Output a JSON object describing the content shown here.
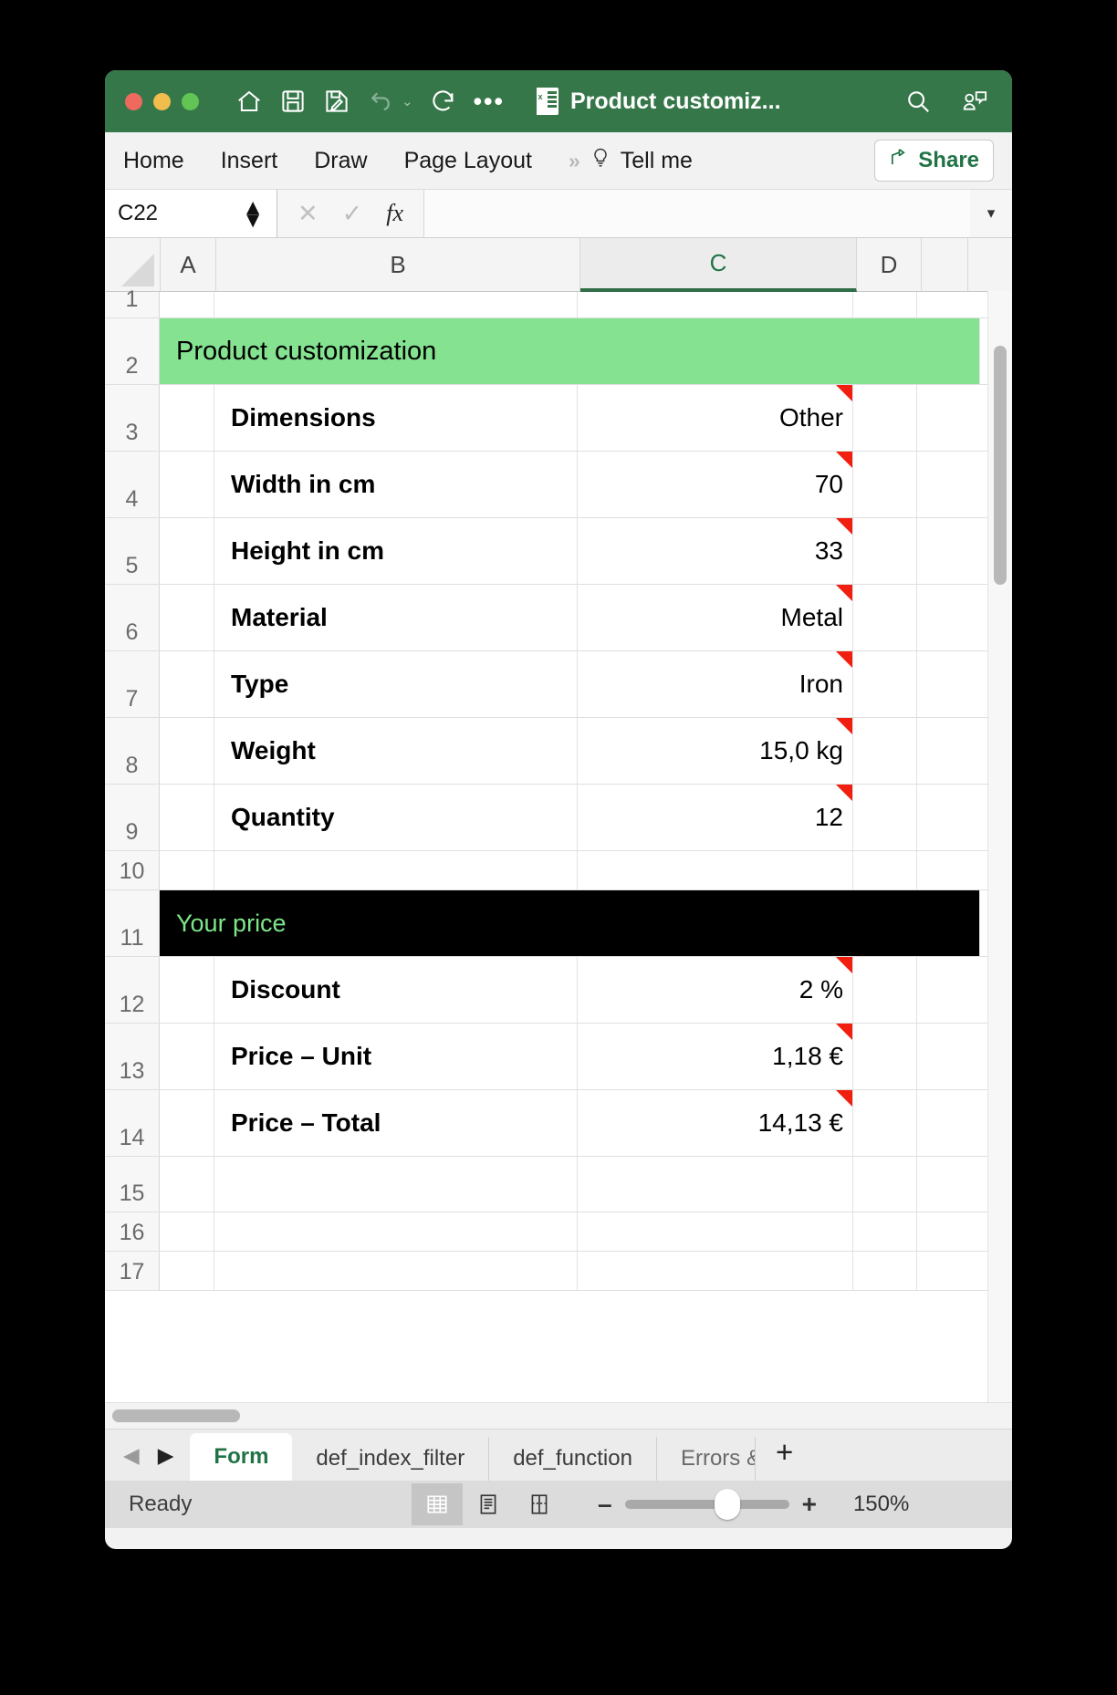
{
  "window": {
    "title": "Product customiz...",
    "file_icon": "excel-file-icon"
  },
  "titlebar": {
    "quick_access": [
      {
        "name": "home-icon",
        "label": "Home"
      },
      {
        "name": "save-icon",
        "label": "Save"
      },
      {
        "name": "save-as-icon",
        "label": "Save As"
      },
      {
        "name": "undo-icon",
        "label": "Undo"
      },
      {
        "name": "undo-dropdown-icon",
        "label": "⌄"
      },
      {
        "name": "redo-icon",
        "label": "Redo"
      },
      {
        "name": "more-commands-icon",
        "label": "•••"
      }
    ],
    "search_icon": "search-icon",
    "collaborate_icon": "comments-person-icon"
  },
  "ribbon": {
    "tabs": [
      "Home",
      "Insert",
      "Draw",
      "Page Layout"
    ],
    "overflow": "»",
    "tell_me": "Tell me",
    "tell_me_icon": "lightbulb-icon",
    "share_label": "Share",
    "share_icon": "share-arrow-icon"
  },
  "formula_bar": {
    "name_box": "C22",
    "cancel_icon": "cancel-x-icon",
    "confirm_icon": "confirm-check-icon",
    "function_icon": "fx-icon",
    "formula_value": "",
    "expand_icon": "chevron-down-icon"
  },
  "grid": {
    "columns": [
      "A",
      "B",
      "C",
      "D"
    ],
    "selected_column": "C",
    "rows": [
      {
        "n": "1",
        "b": "",
        "c": "",
        "comment": false,
        "type": "normal"
      },
      {
        "n": "2",
        "banner": "Product customization",
        "style": "green"
      },
      {
        "n": "3",
        "b": "Dimensions",
        "c": "Other",
        "comment": true,
        "type": "normal"
      },
      {
        "n": "4",
        "b": "Width in cm",
        "c": "70",
        "comment": true,
        "type": "normal"
      },
      {
        "n": "5",
        "b": "Height in cm",
        "c": "33",
        "comment": true,
        "type": "normal"
      },
      {
        "n": "6",
        "b": "Material",
        "c": "Metal",
        "comment": true,
        "type": "normal"
      },
      {
        "n": "7",
        "b": "Type",
        "c": "Iron",
        "comment": true,
        "type": "normal"
      },
      {
        "n": "8",
        "b": "Weight",
        "c": "15,0 kg",
        "comment": true,
        "type": "normal"
      },
      {
        "n": "9",
        "b": "Quantity",
        "c": "12",
        "comment": true,
        "type": "normal"
      },
      {
        "n": "10",
        "b": "",
        "c": "",
        "comment": false,
        "type": "normal"
      },
      {
        "n": "11",
        "banner": "Your price",
        "style": "black"
      },
      {
        "n": "12",
        "b": "Discount",
        "c": "2 %",
        "comment": true,
        "type": "normal"
      },
      {
        "n": "13",
        "b": "Price – Unit",
        "c": "1,18 €",
        "comment": true,
        "type": "normal"
      },
      {
        "n": "14",
        "b": "Price – Total",
        "c": "14,13 €",
        "comment": true,
        "type": "normal"
      },
      {
        "n": "15",
        "b": "",
        "c": "",
        "comment": false,
        "type": "normal"
      },
      {
        "n": "16",
        "b": "",
        "c": "",
        "comment": false,
        "type": "normal"
      },
      {
        "n": "17",
        "b": "",
        "c": "",
        "comment": false,
        "type": "normal"
      }
    ]
  },
  "sheet_tabs": {
    "prev_icon": "arrow-left-icon",
    "next_icon": "arrow-right-icon",
    "tabs": [
      {
        "label": "Form",
        "active": true
      },
      {
        "label": "def_index_filter",
        "active": false
      },
      {
        "label": "def_function",
        "active": false
      },
      {
        "label": "Errors &",
        "active": false
      }
    ],
    "add_label": "+"
  },
  "status_bar": {
    "status": "Ready",
    "views": [
      {
        "name": "normal-view-icon",
        "active": true
      },
      {
        "name": "page-layout-view-icon",
        "active": false
      },
      {
        "name": "page-break-view-icon",
        "active": false
      }
    ],
    "zoom_out": "–",
    "zoom_in": "+",
    "zoom_level": "150%"
  },
  "colors": {
    "title_green": "#36774a",
    "accent_green": "#217346",
    "banner_green": "#84e291",
    "banner_text_green": "#7ee68a",
    "comment_red": "#f01f10"
  }
}
